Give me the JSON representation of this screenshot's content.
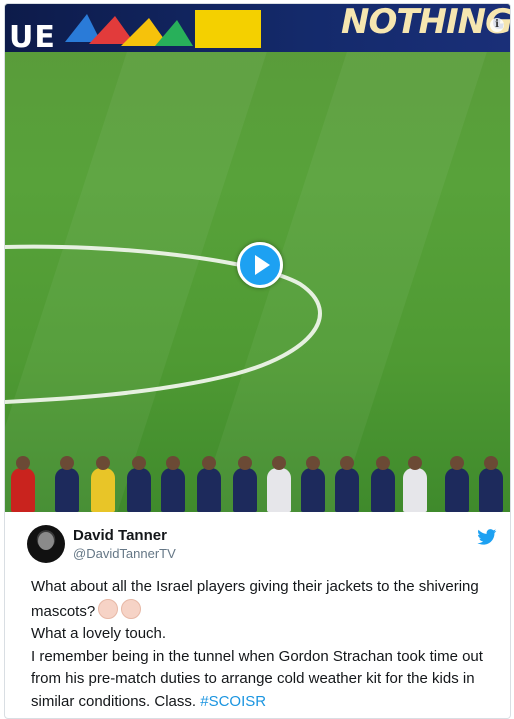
{
  "media": {
    "banner_left_text": "UE",
    "banner_slogan": "NOTHING MATT",
    "sponsor_text": "",
    "info_icon": "info-icon",
    "play_icon": "play-icon"
  },
  "tweet": {
    "display_name": "David Tanner",
    "handle": "@DavidTannerTV",
    "lines": [
      "What about all the Israel players giving their jackets to the shivering mascots?",
      "What a lovely touch.",
      "I remember being in the tunnel when Gordon Strachan took time out from his pre-match duties to arrange cold weather kit for the kids in similar conditions. Class."
    ],
    "hashtag": "#SCOISR",
    "meta_partial": "",
    "bird_icon": "twitter-bird-icon"
  },
  "colors": {
    "accent": "#1da1f2",
    "hashtag": "#1b95e0",
    "text": "#14171a",
    "muted": "#657786"
  }
}
